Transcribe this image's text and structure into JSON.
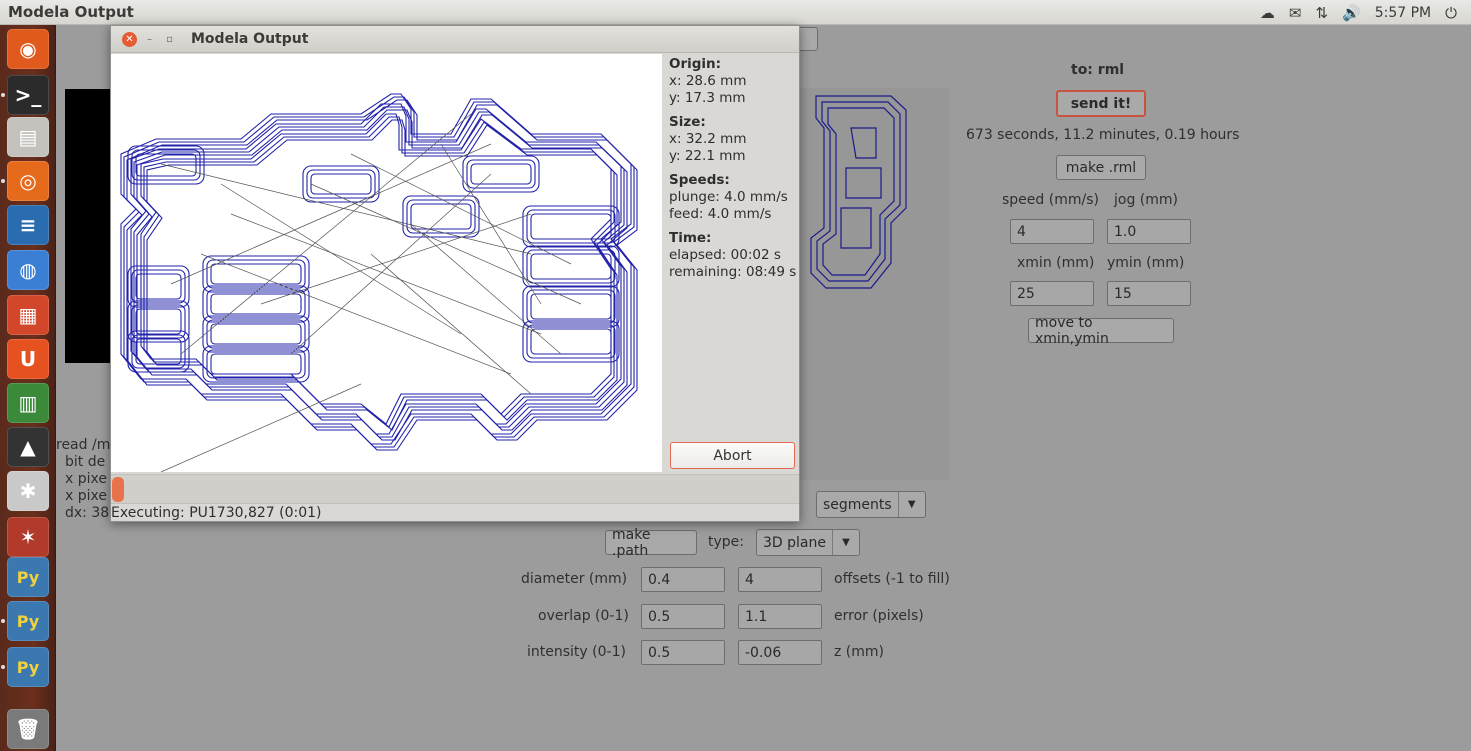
{
  "topbar": {
    "title": "Modela Output",
    "clock": "5:57 PM",
    "tray_icons": [
      "cloud-icon",
      "mail-icon",
      "network-icon",
      "volume-icon",
      "power-icon"
    ]
  },
  "launcher": {
    "items": [
      {
        "name": "ubuntu-home",
        "glyph": "◉"
      },
      {
        "name": "terminal",
        "glyph": ">_"
      },
      {
        "name": "file-manager",
        "glyph": "▤"
      },
      {
        "name": "firefox",
        "glyph": "◎"
      },
      {
        "name": "text-document",
        "glyph": "≡"
      },
      {
        "name": "chromium",
        "glyph": "◍"
      },
      {
        "name": "presentation",
        "glyph": "▦"
      },
      {
        "name": "ubuntu-one",
        "glyph": "U"
      },
      {
        "name": "spreadsheet",
        "glyph": "▥"
      },
      {
        "name": "inkscape",
        "glyph": "▲"
      },
      {
        "name": "system-settings",
        "glyph": "✱"
      },
      {
        "name": "app-red",
        "glyph": "✶"
      },
      {
        "name": "python-1",
        "glyph": "Py"
      },
      {
        "name": "python-2",
        "glyph": "Py"
      },
      {
        "name": "python-3",
        "glyph": "Py"
      },
      {
        "name": "trash",
        "glyph": "🗑"
      }
    ]
  },
  "dialog": {
    "title": "Modela Output",
    "info": {
      "origin_label": "Origin:",
      "origin_x": "x: 28.6 mm",
      "origin_y": "y: 17.3 mm",
      "size_label": "Size:",
      "size_x": "x: 32.2 mm",
      "size_y": "y: 22.1 mm",
      "speeds_label": "Speeds:",
      "plunge": "plunge: 4.0 mm/s",
      "feed": "feed: 4.0 mm/s",
      "time_label": "Time:",
      "elapsed": "elapsed: 00:02 s",
      "remaining": "remaining: 08:49 s"
    },
    "abort_label": "Abort",
    "progress": 0.017,
    "status": "Executing: PU1730,827 (0:01)",
    "trace_color": "#2222aa"
  },
  "bg": {
    "to_label": "to: rml",
    "send_label": "send it!",
    "time_text": "673 seconds, 11.2 minutes, 0.19 hours",
    "make_rml_label": "make .rml",
    "speed_label": "speed (mm/s)",
    "jog_label": "jog (mm)",
    "speed_value": "4",
    "jog_value": "1.0",
    "xmin_label": "xmin (mm)",
    "ymin_label": "ymin (mm)",
    "xmin_value": "25",
    "ymin_value": "15",
    "move_label": "move to xmin,ymin",
    "segments_value": "segments",
    "make_path_label": "make .path",
    "type_label": "type:",
    "type_value": "3D plane",
    "diameter_label": "diameter (mm)",
    "diameter_value": "0.4",
    "offsets_value": "4",
    "offsets_label": "offsets (-1 to fill)",
    "overlap_label": "overlap (0-1)",
    "overlap_value": "0.5",
    "error_value": "1.1",
    "error_label": "error (pixels)",
    "intensity_label": "intensity (0-1)",
    "intensity_value": "0.5",
    "z_value": "-0.06",
    "z_label": "z (mm)",
    "left_text": [
      "read /m",
      "bit de",
      "x pixe",
      "x pixe",
      "dx: 38"
    ]
  }
}
